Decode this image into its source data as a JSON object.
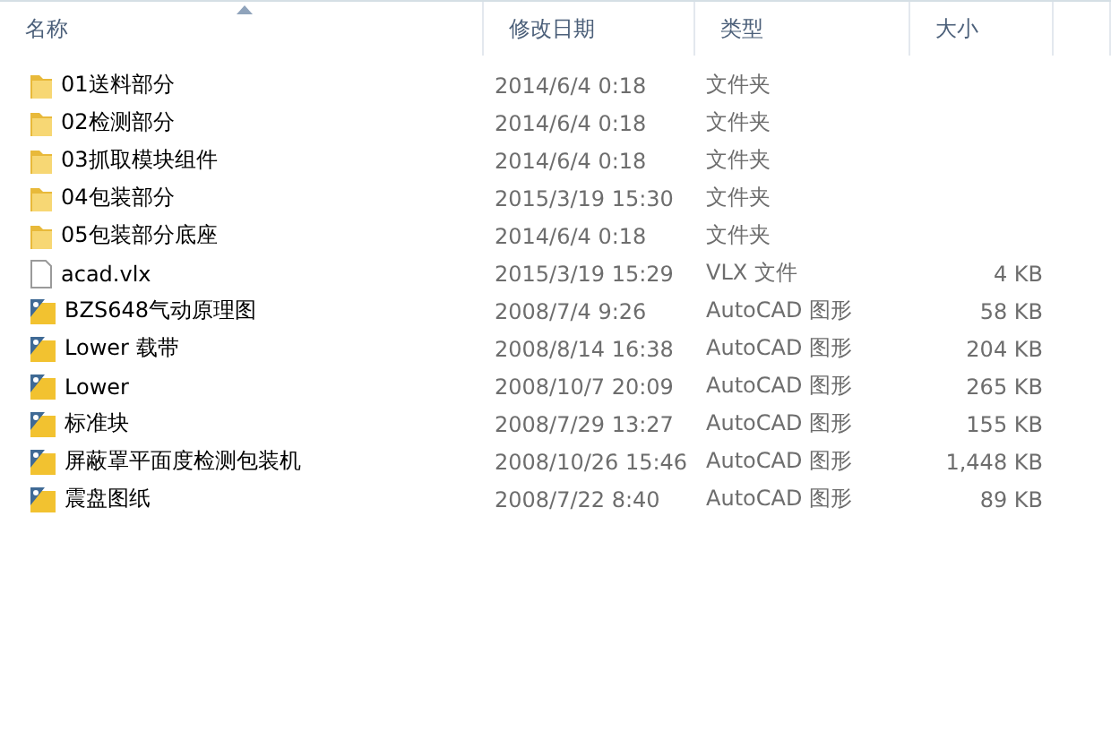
{
  "columns": [
    {
      "label": "名称",
      "sorted": true
    },
    {
      "label": "修改日期",
      "sorted": false
    },
    {
      "label": "类型",
      "sorted": false
    },
    {
      "label": "大小",
      "sorted": false
    }
  ],
  "rows": [
    {
      "kind": "folder",
      "name": "01送料部分",
      "date": "2014/6/4 0:18",
      "type": "文件夹"
    },
    {
      "kind": "folder",
      "name": "02检测部分",
      "date": "2014/6/4 0:18",
      "type": "文件夹"
    },
    {
      "kind": "folder",
      "name": "03抓取模块组件",
      "date": "2014/6/4 0:18",
      "type": "文件夹"
    },
    {
      "kind": "folder",
      "name": "04包装部分",
      "date": "2015/3/19 15:30",
      "type": "文件夹"
    },
    {
      "kind": "folder",
      "name": "05包装部分底座",
      "date": "2014/6/4 0:18",
      "type": "文件夹"
    },
    {
      "kind": "file",
      "name": "acad.vlx",
      "date": "2015/3/19 15:29",
      "type": "VLX 文件",
      "size": "4 KB"
    },
    {
      "kind": "cad",
      "name": "BZS648气动原理图",
      "date": "2008/7/4 9:26",
      "type": "AutoCAD 图形",
      "size": "58 KB"
    },
    {
      "kind": "cad",
      "name": "Lower 载带",
      "date": "2008/8/14 16:38",
      "type": "AutoCAD 图形",
      "size": "204 KB"
    },
    {
      "kind": "cad",
      "name": "Lower",
      "date": "2008/10/7 20:09",
      "type": "AutoCAD 图形",
      "size": "265 KB"
    },
    {
      "kind": "cad",
      "name": "标准块",
      "date": "2008/7/29 13:27",
      "type": "AutoCAD 图形",
      "size": "155 KB"
    },
    {
      "kind": "cad",
      "name": "屏蔽罩平面度检测包装机",
      "date": "2008/10/26 15:46",
      "type": "AutoCAD 图形",
      "size": "1,448 KB"
    },
    {
      "kind": "cad",
      "name": "震盘图纸",
      "date": "2008/7/22 8:40",
      "type": "AutoCAD 图形",
      "size": "89 KB"
    }
  ]
}
